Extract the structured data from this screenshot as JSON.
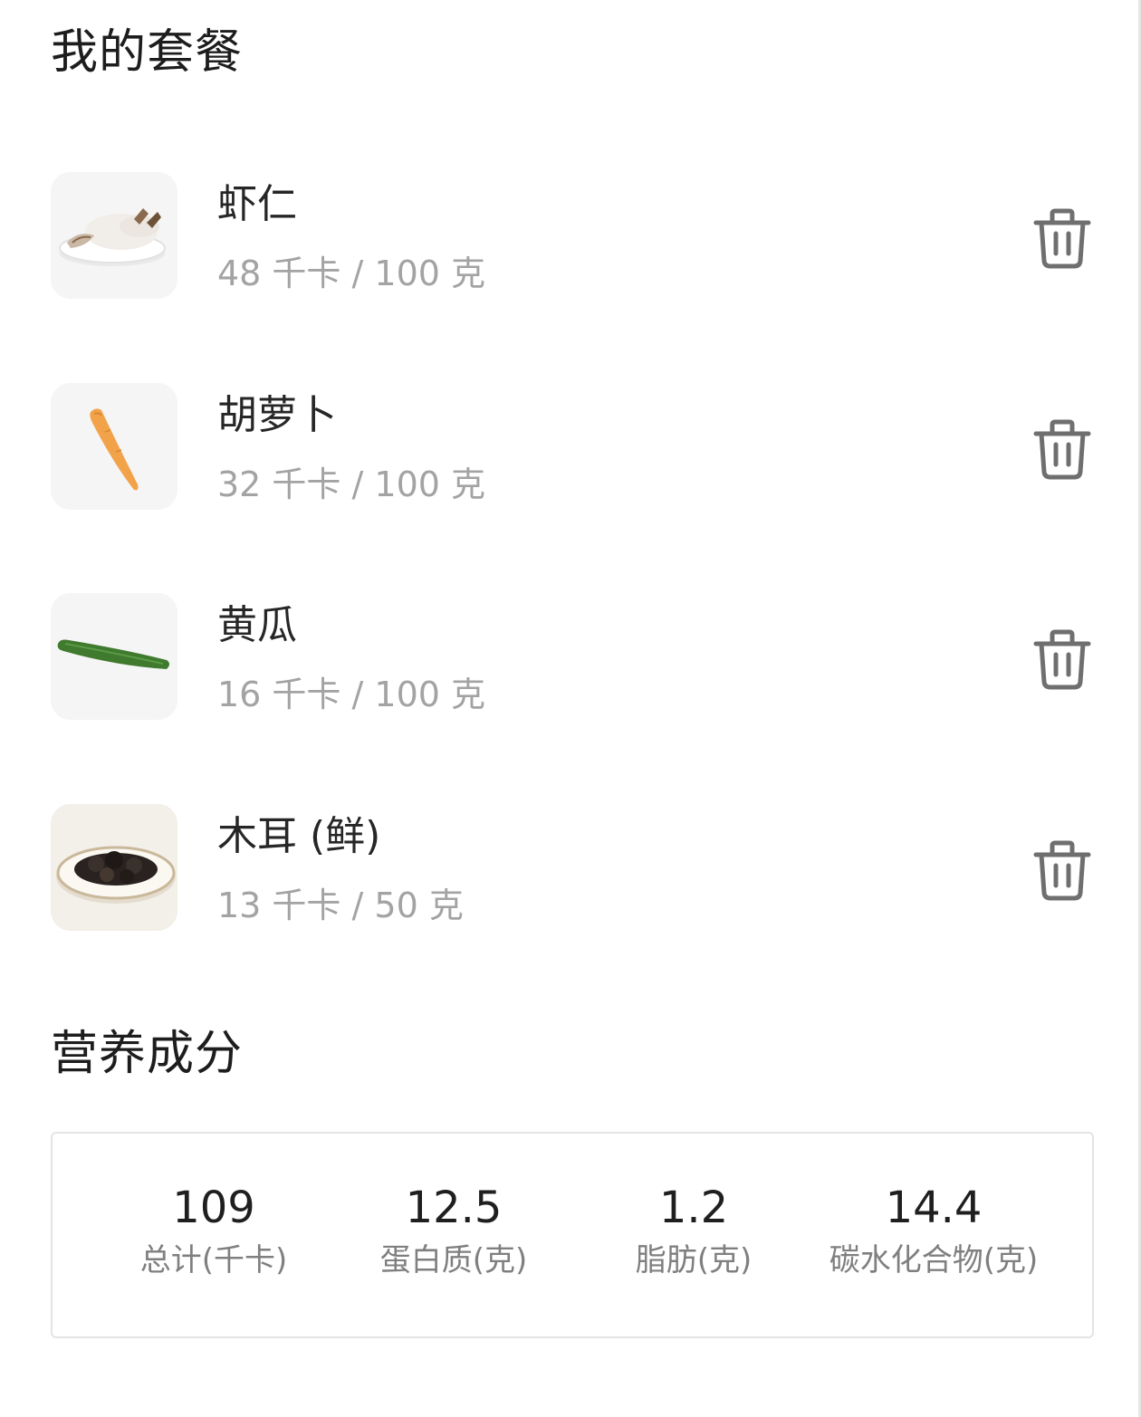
{
  "meal_section": {
    "title": "我的套餐"
  },
  "foods": [
    {
      "name": "虾仁",
      "calories": "48 千卡 / 100 克",
      "image_icon": "shrimp-plate-icon"
    },
    {
      "name": "胡萝卜",
      "calories": "32 千卡 / 100 克",
      "image_icon": "carrot-icon"
    },
    {
      "name": "黄瓜",
      "calories": "16 千卡 / 100 克",
      "image_icon": "cucumber-icon"
    },
    {
      "name": "木耳 (鲜)",
      "calories": "13 千卡 / 50 克",
      "image_icon": "wood-ear-plate-icon"
    }
  ],
  "delete_icon": "trash-icon",
  "nutrition_section": {
    "title": "营养成分",
    "items": [
      {
        "value": "109",
        "label": "总计(千卡)"
      },
      {
        "value": "12.5",
        "label": "蛋白质(克)"
      },
      {
        "value": "1.2",
        "label": "脂肪(克)"
      },
      {
        "value": "14.4",
        "label": "碳水化合物(克)"
      }
    ]
  },
  "colors": {
    "text_primary": "#222222",
    "text_secondary": "#a3a3a3",
    "icon_gray": "#6f6f6f",
    "card_border": "#e4e4e4"
  }
}
